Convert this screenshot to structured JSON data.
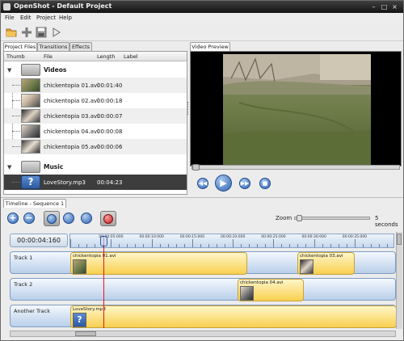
{
  "window": {
    "title": "OpenShot - Default Project"
  },
  "menu": [
    "File",
    "Edit",
    "Project",
    "Help"
  ],
  "toolbar": {
    "icons": [
      "open-folder-icon",
      "add-files-icon",
      "save-icon",
      "play-icon"
    ]
  },
  "left_tabs": [
    "Project Files",
    "Transitions",
    "Effects"
  ],
  "columns": [
    "Thumb",
    "File",
    "Length",
    "Label"
  ],
  "folders": {
    "videos": "Videos",
    "music": "Music"
  },
  "files": [
    {
      "name": "chickentopia 01.avi",
      "length": "00:01:40"
    },
    {
      "name": "chickentopia 02.avi",
      "length": "00:00:18"
    },
    {
      "name": "chickentopia 03.avi",
      "length": "00:00:07"
    },
    {
      "name": "chickentopia 04.avi",
      "length": "00:00:08"
    },
    {
      "name": "chickentopia 05.avi",
      "length": "00:00:06"
    }
  ],
  "music_file": {
    "name": "LoveStory.mp3",
    "length": "00:04:23"
  },
  "preview_tab": "Video Preview",
  "timeline": {
    "tab": "Timeline - Sequence 1",
    "zoom_label": "Zoom",
    "zoom_value": "5 seconds",
    "current_time": "00:00:04:160",
    "ticks": [
      "00:00:05:000",
      "00:00:10:000",
      "00:00:15:000",
      "00:00:20:000",
      "00:00:25:000",
      "00:00:30:000",
      "00:00:35:000"
    ],
    "tracks": [
      {
        "name": "Track 1",
        "clips": [
          "chickentopia 01.avi",
          "chickentopia 03.avi"
        ]
      },
      {
        "name": "Track 2",
        "clips": [
          "chickentopia 04.avi"
        ]
      },
      {
        "name": "Another Track",
        "clips": [
          "LoveStory.mp3"
        ]
      }
    ]
  }
}
